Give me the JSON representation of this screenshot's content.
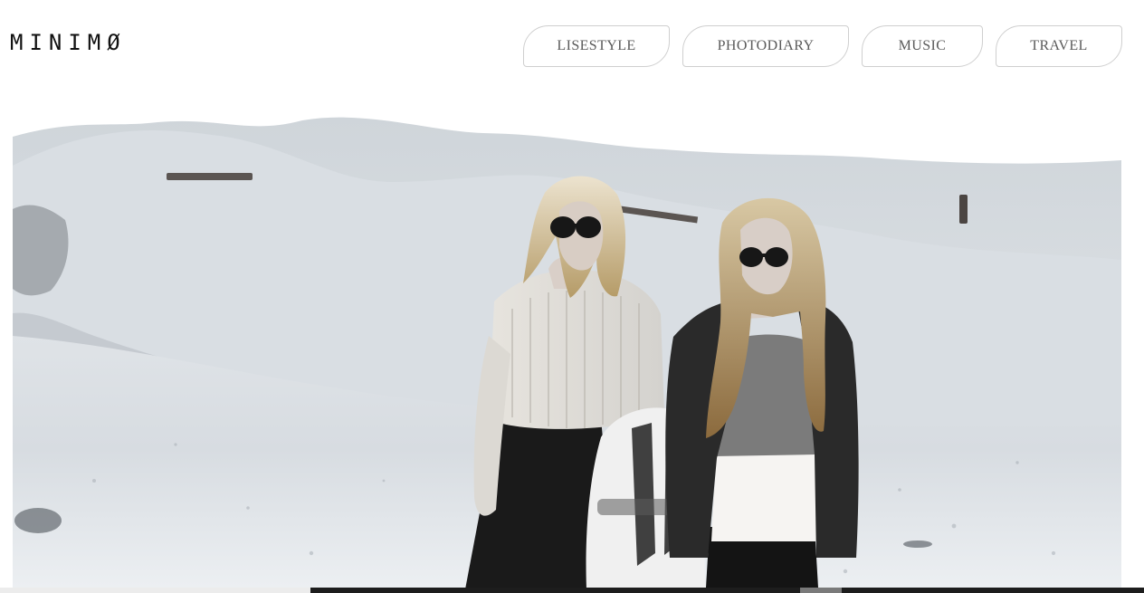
{
  "header": {
    "logo": "MINIMØ",
    "nav": [
      {
        "label": "LISESTYLE"
      },
      {
        "label": "PHOTODIARY"
      },
      {
        "label": "MUSIC"
      },
      {
        "label": "TRAVEL"
      }
    ]
  },
  "hero": {
    "image_subject": "two-women-on-white-dunes",
    "palette": {
      "sand": "#e9ecef",
      "shadow": "#c9ced4",
      "dark": "#1a1a1a",
      "hair": "#c8b27f",
      "hair_light": "#e3dbc7"
    }
  },
  "icons": {
    "logo": "wordmark"
  }
}
